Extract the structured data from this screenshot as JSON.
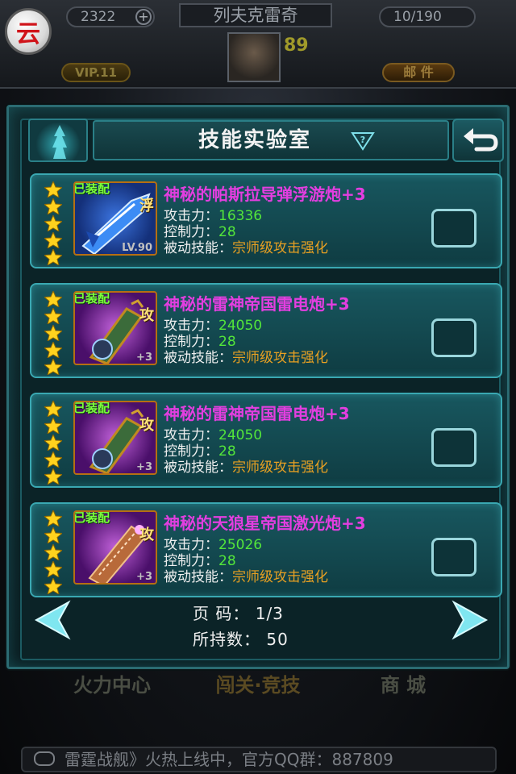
{
  "hud": {
    "currency_value": "2322",
    "plus": "+",
    "player_name": "列夫克雷奇",
    "level": "89",
    "capacity": "10/190",
    "vip": "VIP.11",
    "mail": "邮 件",
    "cloud_glyph": "云"
  },
  "modal": {
    "title": "技能实验室",
    "help_glyph": "?",
    "items": [
      {
        "equipped": "已装配",
        "type": "浮",
        "level_badge": "LV.90",
        "name": "神秘的帕斯拉导弹浮游炮+3",
        "attack_label": "攻击力：",
        "attack": "16336",
        "control_label": "控制力：",
        "control": "28",
        "skill_label": "被动技能：",
        "skill": "宗师级攻击强化"
      },
      {
        "equipped": "已装配",
        "type": "攻",
        "level_badge": "+3",
        "name": "神秘的雷神帝国雷电炮+3",
        "attack_label": "攻击力：",
        "attack": "24050",
        "control_label": "控制力：",
        "control": "28",
        "skill_label": "被动技能：",
        "skill": "宗师级攻击强化"
      },
      {
        "equipped": "已装配",
        "type": "攻",
        "level_badge": "+3",
        "name": "神秘的雷神帝国雷电炮+3",
        "attack_label": "攻击力：",
        "attack": "24050",
        "control_label": "控制力：",
        "control": "28",
        "skill_label": "被动技能：",
        "skill": "宗师级攻击强化"
      },
      {
        "equipped": "已装配",
        "type": "攻",
        "level_badge": "+3",
        "name": "神秘的天狼星帝国激光炮+3",
        "attack_label": "攻击力：",
        "attack": "25026",
        "control_label": "控制力：",
        "control": "28",
        "skill_label": "被动技能：",
        "skill": "宗师级攻击强化"
      }
    ],
    "page_label": "页 码：",
    "page_value": "1/3",
    "owned_label": "所持数：",
    "owned_value": "50"
  },
  "nav": {
    "left": "火力中心",
    "center": "闯关·竞技",
    "right": "商 城"
  },
  "ticker": "雷霆战舰》火热上线中，官方QQ群：887809",
  "colors": {
    "panel": "#0f3c42",
    "border": "#3aa8b2",
    "name": "#e33ee0",
    "stat_value": "#53e63a",
    "skill": "#e8a022",
    "equipped": "#7cff3c"
  },
  "stars_per_item": 5
}
